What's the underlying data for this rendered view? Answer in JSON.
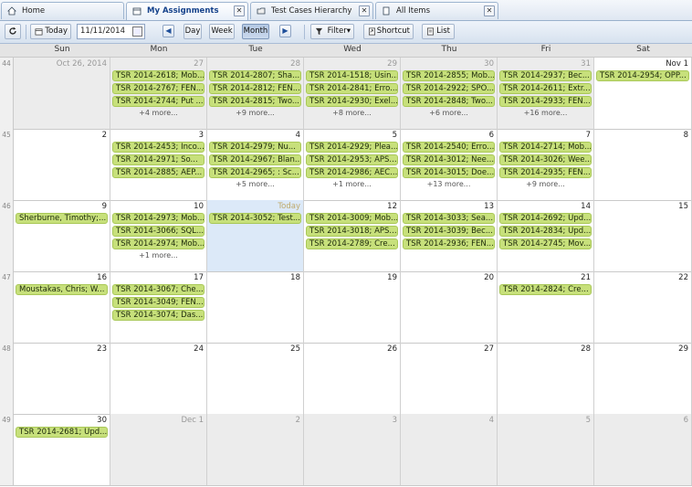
{
  "tabs": [
    {
      "label": "Home",
      "icon": "home-icon",
      "active": false,
      "closable": false
    },
    {
      "label": "My Assignments",
      "icon": "calendar-icon",
      "active": true,
      "closable": true
    },
    {
      "label": "Test Cases Hierarchy",
      "icon": "folder-icon",
      "active": false,
      "closable": true
    },
    {
      "label": "All Items",
      "icon": "document-icon",
      "active": false,
      "closable": true
    }
  ],
  "toolbar": {
    "today_label": "Today",
    "date_value": "11/11/2014",
    "day_label": "Day",
    "week_label": "Week",
    "month_label": "Month",
    "filter_label": "Filter",
    "shortcut_label": "Shortcut",
    "list_label": "List",
    "active_view": "Month"
  },
  "weekdays": [
    "Sun",
    "Mon",
    "Tue",
    "Wed",
    "Thu",
    "Fri",
    "Sat"
  ],
  "colors": {
    "event": "#c7e07b",
    "today": "#dce9f8",
    "other_month": "#ececec"
  },
  "weeks": [
    {
      "num": "44",
      "days": [
        {
          "label": "Oct 26, 2014",
          "other": true,
          "events": [],
          "more": ""
        },
        {
          "label": "27",
          "other": true,
          "events": [
            "TSR 2014-2618; Mob...",
            "TSR 2014-2767; FEN...",
            "TSR 2014-2744; Put ..."
          ],
          "more": "+4 more..."
        },
        {
          "label": "28",
          "other": true,
          "events": [
            "TSR 2014-2807; Sha...",
            "TSR 2014-2812; FEN...",
            "TSR 2014-2815; Two..."
          ],
          "more": "+9 more..."
        },
        {
          "label": "29",
          "other": true,
          "events": [
            "TSR 2014-1518; Usin...",
            "TSR 2014-2841; Erro...",
            "TSR 2014-2930; Exel..."
          ],
          "more": "+8 more..."
        },
        {
          "label": "30",
          "other": true,
          "events": [
            "TSR 2014-2855; Mob...",
            "TSR 2014-2922; SPO...",
            "TSR 2014-2848; Two..."
          ],
          "more": "+6 more..."
        },
        {
          "label": "31",
          "other": true,
          "events": [
            "TSR 2014-2937; Bec...",
            "TSR 2014-2611; Extr...",
            "TSR 2014-2933; FEN..."
          ],
          "more": "+16 more..."
        },
        {
          "label": "Nov 1",
          "other": false,
          "events": [
            "TSR 2014-2954; OPP..."
          ],
          "more": ""
        }
      ]
    },
    {
      "num": "45",
      "days": [
        {
          "label": "2",
          "other": false,
          "events": [],
          "more": ""
        },
        {
          "label": "3",
          "other": false,
          "events": [
            "TSR 2014-2453; Inco...",
            "TSR 2014-2971; So...",
            "TSR 2014-2885; AEP..."
          ],
          "more": ""
        },
        {
          "label": "4",
          "other": false,
          "events": [
            "TSR 2014-2979; Nu...",
            "TSR 2014-2967; Blan...",
            "TSR 2014-2965; : Sc..."
          ],
          "more": "+5 more..."
        },
        {
          "label": "5",
          "other": false,
          "events": [
            "TSR 2014-2929; Plea...",
            "TSR 2014-2953; APS...",
            "TSR 2014-2986; AEC..."
          ],
          "more": "+1 more..."
        },
        {
          "label": "6",
          "other": false,
          "events": [
            "TSR 2014-2540; Erro...",
            "TSR 2014-3012; Nee...",
            "TSR 2014-3015; Doe..."
          ],
          "more": "+13 more..."
        },
        {
          "label": "7",
          "other": false,
          "events": [
            "TSR 2014-2714; Mob...",
            "TSR 2014-3026; Wee...",
            "TSR 2014-2935; FEN..."
          ],
          "more": "+9 more..."
        },
        {
          "label": "8",
          "other": false,
          "events": [],
          "more": ""
        }
      ]
    },
    {
      "num": "46",
      "days": [
        {
          "label": "9",
          "other": false,
          "events": [
            "Sherburne, Timothy;..."
          ],
          "more": ""
        },
        {
          "label": "10",
          "other": false,
          "events": [
            "TSR 2014-2973; Mob...",
            "TSR 2014-3066; SQL...",
            "TSR 2014-2974; Mob..."
          ],
          "more": "+1 more..."
        },
        {
          "label": "Today",
          "other": false,
          "today": true,
          "events": [
            "TSR 2014-3052; Test..."
          ],
          "more": ""
        },
        {
          "label": "12",
          "other": false,
          "events": [
            "TSR 2014-3009; Mob...",
            "TSR 2014-3018; APS...",
            "TSR 2014-2789; Cre..."
          ],
          "more": ""
        },
        {
          "label": "13",
          "other": false,
          "events": [
            "TSR 2014-3033; Sea...",
            "TSR 2014-3039; Bec...",
            "TSR 2014-2936; FEN..."
          ],
          "more": ""
        },
        {
          "label": "14",
          "other": false,
          "events": [
            "TSR 2014-2692; Upd...",
            "TSR 2014-2834; Upd...",
            "TSR 2014-2745; Mov..."
          ],
          "more": ""
        },
        {
          "label": "15",
          "other": false,
          "events": [],
          "more": ""
        }
      ]
    },
    {
      "num": "47",
      "days": [
        {
          "label": "16",
          "other": false,
          "events": [
            "Moustakas, Chris; W..."
          ],
          "more": ""
        },
        {
          "label": "17",
          "other": false,
          "events": [
            "TSR 2014-3067; Che...",
            "TSR 2014-3049; FEN...",
            "TSR 2014-3074; Das..."
          ],
          "more": ""
        },
        {
          "label": "18",
          "other": false,
          "events": [],
          "more": ""
        },
        {
          "label": "19",
          "other": false,
          "events": [],
          "more": ""
        },
        {
          "label": "20",
          "other": false,
          "events": [],
          "more": ""
        },
        {
          "label": "21",
          "other": false,
          "events": [
            "TSR 2014-2824; Cre..."
          ],
          "more": ""
        },
        {
          "label": "22",
          "other": false,
          "events": [],
          "more": ""
        }
      ]
    },
    {
      "num": "48",
      "days": [
        {
          "label": "23",
          "other": false,
          "events": [],
          "more": ""
        },
        {
          "label": "24",
          "other": false,
          "events": [],
          "more": ""
        },
        {
          "label": "25",
          "other": false,
          "events": [],
          "more": ""
        },
        {
          "label": "26",
          "other": false,
          "events": [],
          "more": ""
        },
        {
          "label": "27",
          "other": false,
          "events": [],
          "more": ""
        },
        {
          "label": "28",
          "other": false,
          "events": [],
          "more": ""
        },
        {
          "label": "29",
          "other": false,
          "events": [],
          "more": ""
        }
      ]
    },
    {
      "num": "49",
      "days": [
        {
          "label": "30",
          "other": false,
          "events": [
            "TSR 2014-2681; Upd..."
          ],
          "more": ""
        },
        {
          "label": "Dec 1",
          "other": true,
          "events": [],
          "more": ""
        },
        {
          "label": "2",
          "other": true,
          "events": [],
          "more": ""
        },
        {
          "label": "3",
          "other": true,
          "events": [],
          "more": ""
        },
        {
          "label": "4",
          "other": true,
          "events": [],
          "more": ""
        },
        {
          "label": "5",
          "other": true,
          "events": [],
          "more": ""
        },
        {
          "label": "6",
          "other": true,
          "events": [],
          "more": ""
        }
      ]
    }
  ]
}
